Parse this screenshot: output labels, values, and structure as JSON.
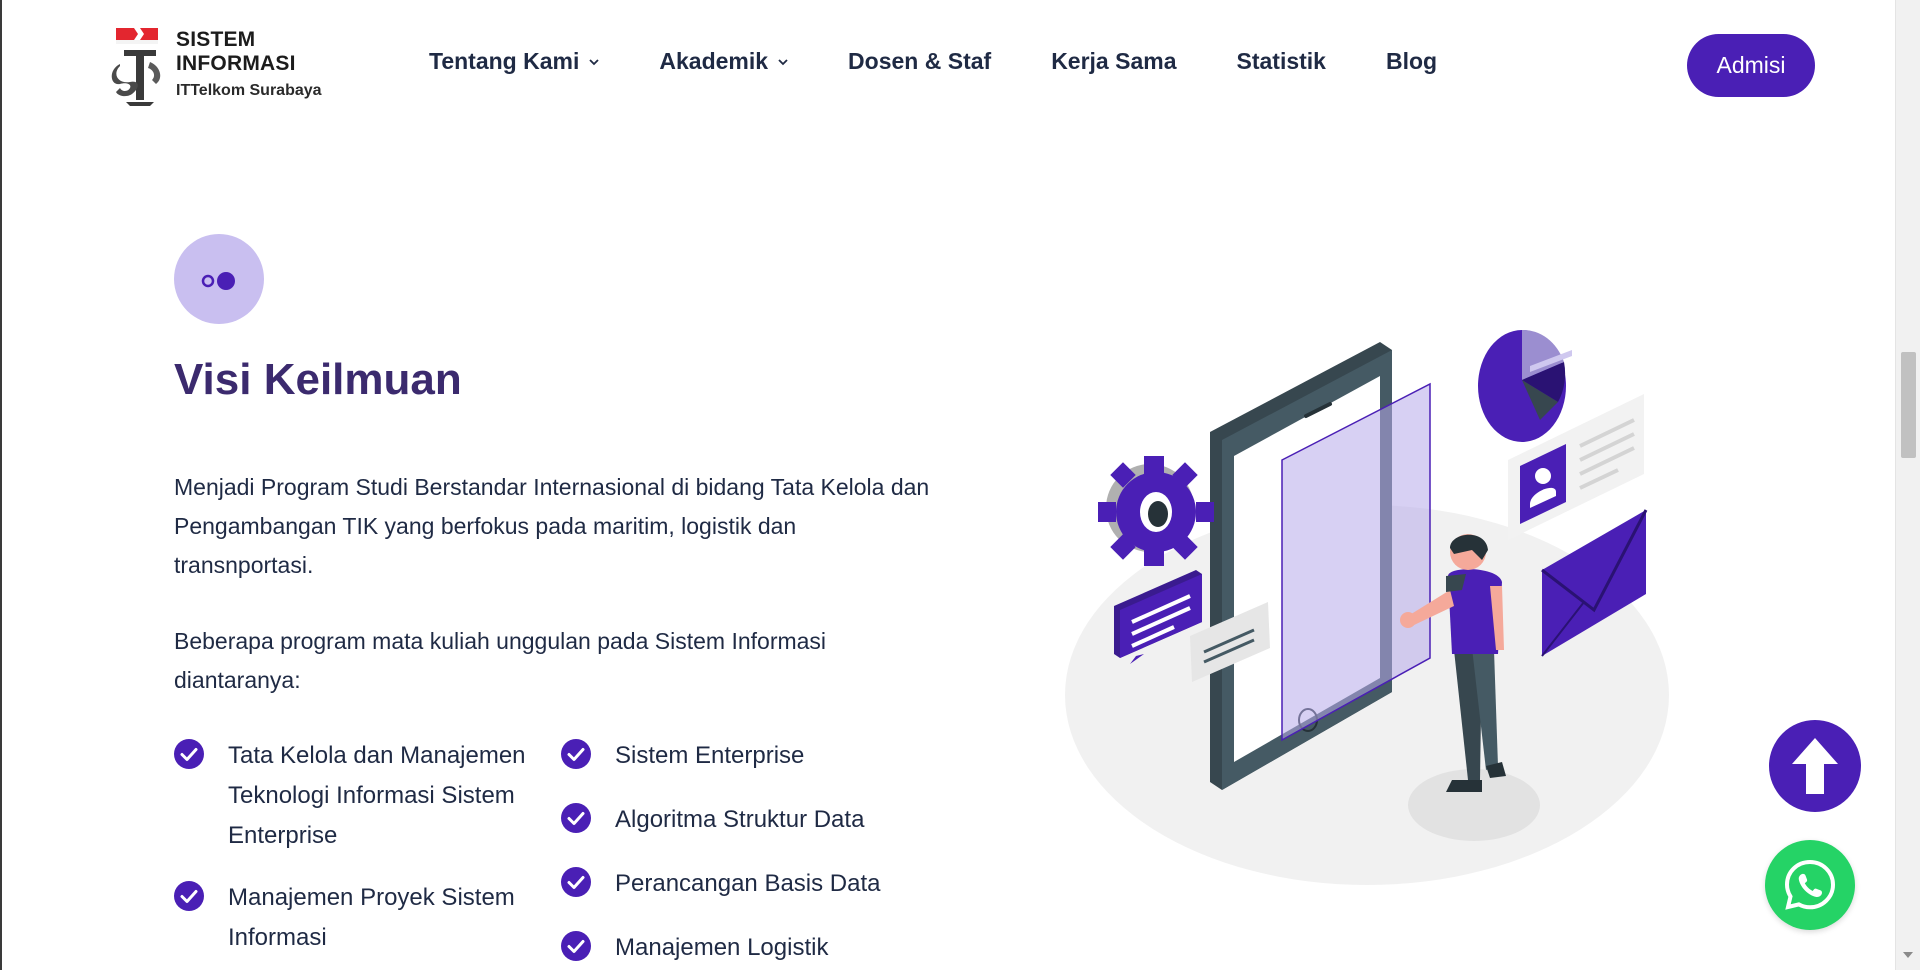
{
  "colors": {
    "brand": "#4a1fb5",
    "title": "#3b2a6e",
    "text": "#1f2a44",
    "icon_bg": "#c9bff0",
    "whatsapp": "#25d366"
  },
  "logo": {
    "line1": "SISTEM",
    "line2": "INFORMASI",
    "line3": "ITTelkom Surabaya"
  },
  "nav": {
    "items": [
      {
        "label": "Tentang Kami",
        "has_dropdown": true
      },
      {
        "label": "Akademik",
        "has_dropdown": true
      },
      {
        "label": "Dosen & Staf",
        "has_dropdown": false
      },
      {
        "label": "Kerja Sama",
        "has_dropdown": false
      },
      {
        "label": "Statistik",
        "has_dropdown": false
      },
      {
        "label": "Blog",
        "has_dropdown": false
      }
    ],
    "cta_label": "Admisi"
  },
  "section": {
    "icon": "two-dots-icon",
    "title": "Visi Keilmuan",
    "paragraph1": "Menjadi Program Studi Berstandar Internasional di bidang Tata Kelola dan Pengambangan TIK yang berfokus pada maritim, logistik dan transnportasi.",
    "paragraph2": "Beberapa program mata kuliah unggulan pada Sistem Informasi diantaranya:",
    "list_left": [
      "Tata Kelola dan Manajemen Teknologi Informasi Sistem Enterprise",
      "Manajemen Proyek Sistem Informasi"
    ],
    "list_right": [
      "Sistem Enterprise",
      "Algoritma Struktur Data",
      "Perancangan Basis Data",
      "Manajemen Logistik"
    ]
  },
  "illustration": {
    "icon": "mobile-app-illustration"
  },
  "floating": {
    "scroll_top_icon": "arrow-up-icon",
    "whatsapp_icon": "whatsapp-icon"
  }
}
